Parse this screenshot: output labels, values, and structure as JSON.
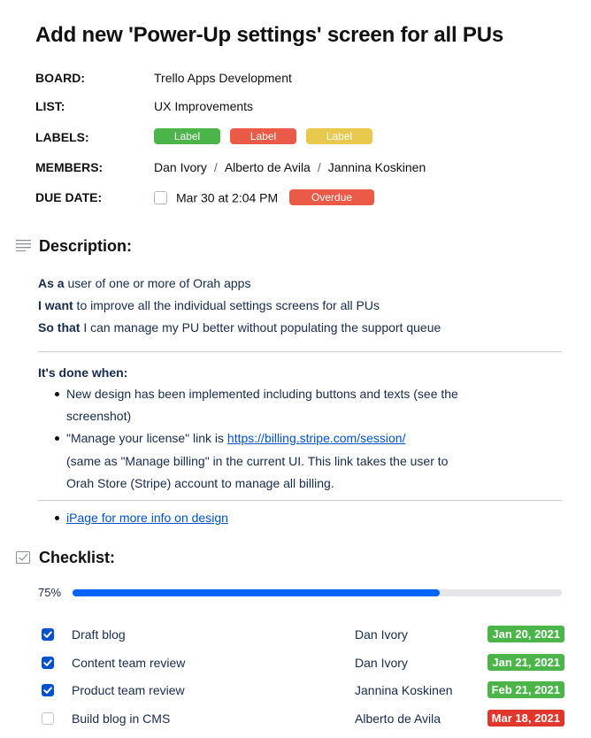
{
  "card": {
    "title": "Add new 'Power-Up settings' screen for all PUs"
  },
  "meta": {
    "board_label": "BOARD:",
    "board_value": "Trello Apps Development",
    "list_label": "LIST:",
    "list_value": "UX Improvements",
    "labels_label": "LABELS:",
    "labels": [
      {
        "text": "Label",
        "color": "#4bb54a"
      },
      {
        "text": "Label",
        "color": "#eb5a46"
      },
      {
        "text": "Label",
        "color": "#e8c94d"
      }
    ],
    "members_label": "MEMBERS:",
    "members": [
      "Dan Ivory",
      "Alberto de Avila",
      "Jannina Koskinen"
    ],
    "member_separator": "/",
    "due_label": "DUE DATE:",
    "due_value": "Mar 30 at 2:04 PM",
    "due_status": "Overdue",
    "due_status_color": "#eb5a46"
  },
  "description": {
    "heading": "Description:",
    "as_a_bold": "As a",
    "as_a_text": " user of one or more of Orah apps",
    "i_want_bold": "I want",
    "i_want_text": " to improve all the individual settings screens for all PUs",
    "so_that_bold": "So that",
    "so_that_text": " I can manage my PU better without populating the support queue",
    "done_heading": "It's done when:",
    "done_item1_line1": "New design has been implemented including buttons and texts (see the",
    "done_item1_line2": "screenshot)",
    "done_item2_prefix": "\"Manage your license\" link is ",
    "done_item2_link": "https://billing.stripe.com/session/",
    "done_item2_line2": "(same as \"Manage billing\" in the current UI. This link takes the user to",
    "done_item2_line3": "Orah Store (Stripe) account to manage all billing.",
    "more_info_link": "iPage for more info on design"
  },
  "checklist": {
    "heading": "Checklist:",
    "progress_label": "75%",
    "progress_fraction": 0.75,
    "items": [
      {
        "text": "Draft blog",
        "member": "Dan Ivory",
        "date": "Jan 20, 2021",
        "checked": true,
        "date_color": "#4bb54a"
      },
      {
        "text": "Content team review",
        "member": "Dan Ivory",
        "date": "Jan 21, 2021",
        "checked": true,
        "date_color": "#4bb54a"
      },
      {
        "text": "Product team review",
        "member": "Jannina Koskinen",
        "date": "Feb 21, 2021",
        "checked": true,
        "date_color": "#4bb54a"
      },
      {
        "text": "Build blog in CMS",
        "member": "Alberto de Avila",
        "date": "Mar 18, 2021",
        "checked": false,
        "date_color": "#e0362c"
      }
    ]
  },
  "icons": {
    "description": "text-lines-icon",
    "checklist": "checkbox-icon",
    "check": "check-icon"
  },
  "colors": {
    "progress_fill": "#0065ff",
    "checkbox_checked": "#0052cc",
    "link": "#0052cc"
  }
}
